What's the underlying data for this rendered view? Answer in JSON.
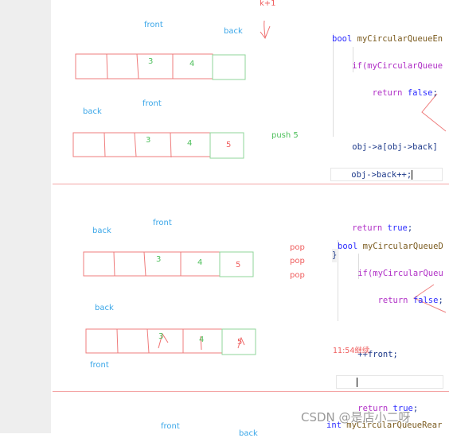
{
  "section1": {
    "k_plus_1": "k+1",
    "top_front": "front",
    "top_back": "back",
    "row1_cells": [
      "",
      "",
      "3",
      "4",
      ""
    ],
    "row2_back": "back",
    "row2_front": "front",
    "row2_cells": [
      "",
      "",
      "3",
      "4",
      "5"
    ],
    "push_label": "push  5",
    "code": {
      "l1_kw": "bool",
      "l1_fn": " myCircularQueueEn",
      "l2_ctl": "if",
      "l2_rest": "(myCircularQueue",
      "l3_ctl": "return",
      "l3_kw": " false",
      "l3_end": ";",
      "l5": "obj->a[obj->back]",
      "l6": "obj->back++;",
      "l8_ctl": "return",
      "l8_kw": " true",
      "l8_end": ";",
      "l9": "}"
    }
  },
  "section2": {
    "row1_back": "back",
    "row1_front": "front",
    "row1_cells": [
      "",
      "",
      "3",
      "4",
      "5"
    ],
    "pop_labels": [
      "pop",
      "pop",
      "pop"
    ],
    "row2_back": "back",
    "row2_cells": [
      "",
      "",
      "3",
      "4",
      "5"
    ],
    "row2_front": "front",
    "code": {
      "l1_kw": "bool",
      "l1_fn": " myCircularQueueD",
      "l2_ctl": "if",
      "l2_rest": "(myCircularQueu",
      "l3_ctl": "return",
      "l3_kw": " false",
      "l3_end": ";",
      "l5": "++front;",
      "l7_ctl": "return",
      "l7_kw": " true",
      "l7_end": ";"
    },
    "note": "11:54继续"
  },
  "section3": {
    "front": "front",
    "back": "back",
    "code_kw": "int",
    "code_fn": " myCircularQueueRear"
  },
  "watermark": "CSDN @是店小二呀",
  "colors": {
    "pointer_label": "#3aa6e8",
    "array_border": "#ef6f6f",
    "new_slot_border": "#8fd69a",
    "value_green": "#4cbf5a",
    "value_red": "#ef5c5c"
  }
}
